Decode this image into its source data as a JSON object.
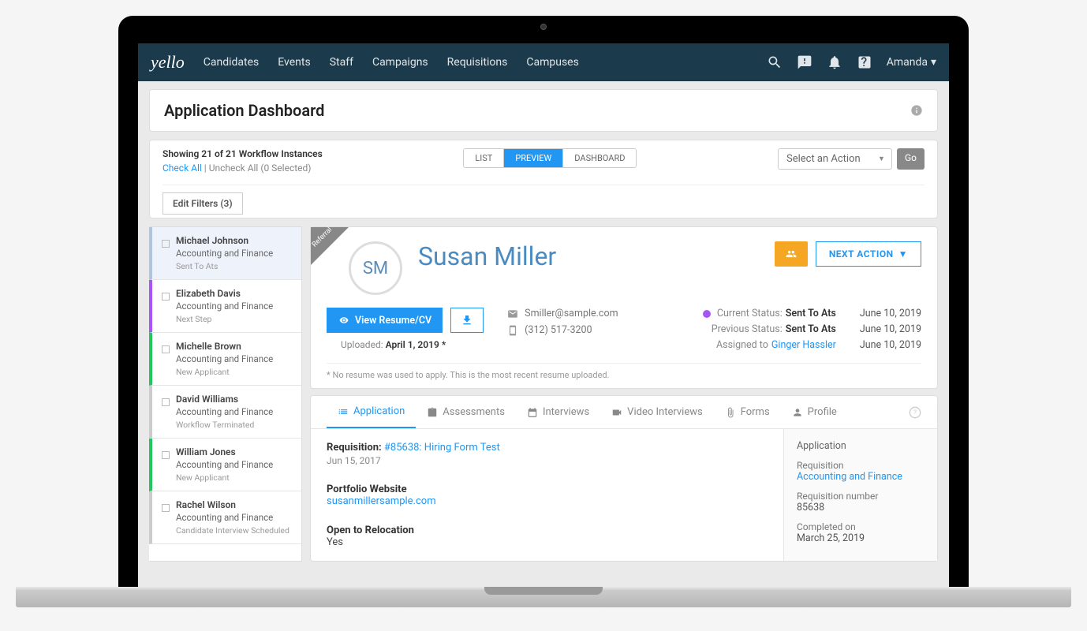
{
  "nav": {
    "logo": "yello",
    "items": [
      "Candidates",
      "Events",
      "Staff",
      "Campaigns",
      "Requisitions",
      "Campuses"
    ],
    "user": "Amanda"
  },
  "page": {
    "title": "Application Dashboard",
    "showing": "Showing 21 of 21 Workflow Instances",
    "check_all": "Check All",
    "uncheck_all": "Uncheck All",
    "selected": "(0 Selected)",
    "view_modes": [
      "LIST",
      "PREVIEW",
      "DASHBOARD"
    ],
    "action_placeholder": "Select an Action",
    "go": "Go",
    "edit_filters": "Edit Filters (3)"
  },
  "candidates": [
    {
      "name": "Michael Johnson",
      "dept": "Accounting and Finance",
      "status": "Sent To Ats",
      "color": "selected"
    },
    {
      "name": "Elizabeth Davis",
      "dept": "Accounting and Finance",
      "status": "Next Step",
      "color": "purple"
    },
    {
      "name": "Michelle Brown",
      "dept": "Accounting and Finance",
      "status": "New Applicant",
      "color": "green"
    },
    {
      "name": "David Williams",
      "dept": "Accounting and Finance",
      "status": "Workflow Terminated",
      "color": "gray"
    },
    {
      "name": "William Jones",
      "dept": "Accounting and Finance",
      "status": "New Applicant",
      "color": "green"
    },
    {
      "name": "Rachel Wilson",
      "dept": "Accounting and Finance",
      "status": "Candidate Interview Scheduled",
      "color": "gray"
    }
  ],
  "detail": {
    "ribbon": "Referral",
    "initials": "SM",
    "name": "Susan Miller",
    "next_action": "NEXT ACTION",
    "view_resume": "View Resume/CV",
    "uploaded_label": "Uploaded:",
    "uploaded_date": "April 1, 2019 *",
    "email": "Smiller@sample.com",
    "phone": "(312) 517-3200",
    "current_status_label": "Current Status:",
    "current_status": "Sent To Ats",
    "prev_status_label": "Previous Status:",
    "prev_status": "Sent To Ats",
    "assigned_label": "Assigned to",
    "assigned_to": "Ginger Hassler",
    "date1": "June 10, 2019",
    "date2": "June 10, 2019",
    "date3": "June 10, 2019",
    "footnote": "* No resume was used to apply. This is the most recent resume uploaded."
  },
  "tabs": [
    "Application",
    "Assessments",
    "Interviews",
    "Video Interviews",
    "Forms",
    "Profile"
  ],
  "application": {
    "req_label": "Requisition:",
    "req_link": "#85638: Hiring Form Test",
    "req_date": "Jun 15, 2017",
    "portfolio_label": "Portfolio Website",
    "portfolio_link": "susanmillersample.com",
    "relocation_label": "Open to Relocation",
    "relocation_val": "Yes"
  },
  "sidebar": {
    "title": "Application",
    "req_label": "Requisition",
    "req_val": "Accounting and Finance",
    "num_label": "Requisition number",
    "num_val": "85638",
    "completed_label": "Completed on",
    "completed_val": "March 25, 2019"
  }
}
